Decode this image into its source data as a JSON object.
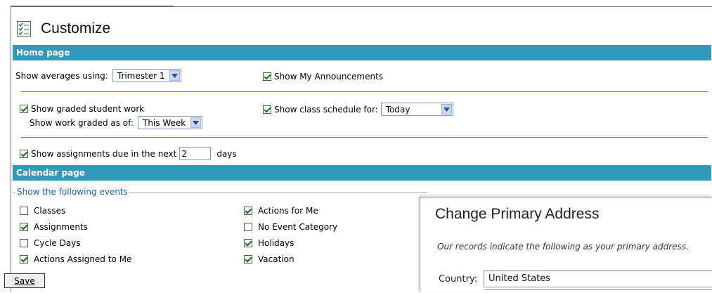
{
  "page": {
    "title": "Customize"
  },
  "home": {
    "section_title": "Home page",
    "averages_label": "Show averages using:",
    "averages_value": "Trimester 1",
    "announcements_label": "Show My Announcements",
    "graded_work_label": "Show graded student work",
    "graded_as_of_label": "Show work graded as of:",
    "graded_as_of_value": "This Week",
    "schedule_label": "Show class schedule for:",
    "schedule_value": "Today",
    "assignments_label": "Show assignments due in the next",
    "assignments_days_value": "2",
    "days_label": "days"
  },
  "calendar": {
    "section_title": "Calendar page",
    "events_legend": "Show the following events",
    "events": [
      {
        "label": "Classes",
        "checked": false
      },
      {
        "label": "Assignments",
        "checked": true
      },
      {
        "label": "Cycle Days",
        "checked": false
      },
      {
        "label": "Actions Assigned to Me",
        "checked": true
      },
      {
        "label": "Actions for Me",
        "checked": true
      },
      {
        "label": "No Event Category",
        "checked": false
      },
      {
        "label": "Holidays",
        "checked": true
      },
      {
        "label": "Vacation",
        "checked": true
      }
    ]
  },
  "save_label": "Save",
  "overlay": {
    "title": "Change Primary Address",
    "note": "Our records indicate the following as your primary address.",
    "country_label": "Country:",
    "country_value": "United States"
  },
  "colors": {
    "section_bar": "#3399bb",
    "legend_text": "#1a5fb4",
    "check_mark": "#0a7a0a"
  },
  "icons": {
    "page_icon": "checklist-icon",
    "dropdown_arrow": "chevron-down-icon"
  }
}
